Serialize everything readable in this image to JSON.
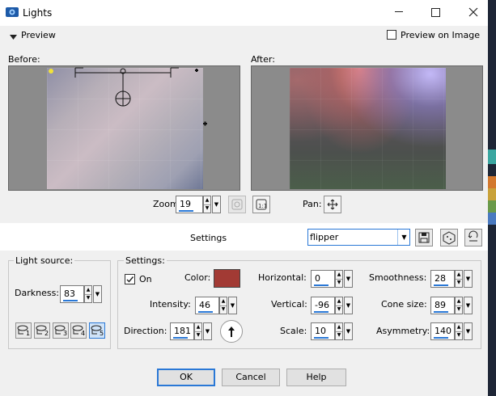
{
  "window": {
    "title": "Lights",
    "accent": "#2a78d6"
  },
  "preview": {
    "toggle_label": "Preview",
    "preview_on_image_label": "Preview on Image",
    "before_label": "Before:",
    "after_label": "After:"
  },
  "zoom": {
    "label": "Zoom:",
    "value": "19"
  },
  "pan": {
    "label": "Pan:"
  },
  "settings_bar": {
    "label": "Settings",
    "preset_value": "flipper"
  },
  "light_source": {
    "title": "Light source:",
    "darkness_label": "Darkness:",
    "darkness_value": "83",
    "lights": [
      "1",
      "2",
      "3",
      "4",
      "5"
    ],
    "selected_light": "5"
  },
  "settings": {
    "title": "Settings:",
    "on_label": "On",
    "on_checked": true,
    "color_label": "Color:",
    "color_value": "#a23a34",
    "intensity_label": "Intensity:",
    "intensity_value": "46",
    "direction_label": "Direction:",
    "direction_value": "181",
    "horizontal_label": "Horizontal:",
    "horizontal_value": "0",
    "vertical_label": "Vertical:",
    "vertical_value": "-96",
    "scale_label": "Scale:",
    "scale_value": "10",
    "smoothness_label": "Smoothness:",
    "smoothness_value": "28",
    "cone_size_label": "Cone size:",
    "cone_size_value": "89",
    "asymmetry_label": "Asymmetry:",
    "asymmetry_value": "140"
  },
  "buttons": {
    "ok": "OK",
    "cancel": "Cancel",
    "help": "Help"
  }
}
